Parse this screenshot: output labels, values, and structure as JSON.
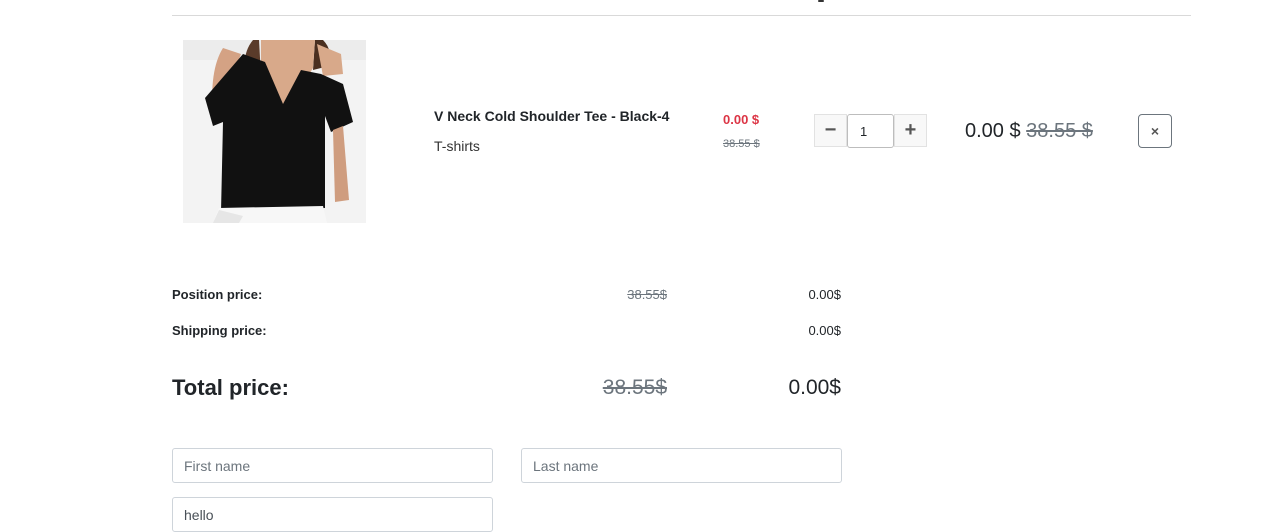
{
  "cart_item": {
    "name": "V Neck Cold Shoulder Tee - Black-4",
    "category": "T-shirts",
    "unit_price": "0.00 $",
    "unit_price_old": "38.55 $",
    "quantity": "1",
    "line_total": "0.00 $",
    "line_total_old": "38.55 $",
    "remove_symbol": "×",
    "minus_symbol": "−",
    "plus_symbol": "+",
    "image_icon": "product-photo"
  },
  "summary": {
    "position_label": "Position price:",
    "position_old": "38.55$",
    "position_new": "0.00$",
    "shipping_label": "Shipping price:",
    "shipping_new": "0.00$",
    "total_label": "Total price:",
    "total_old": "38.55$",
    "total_new": "0.00$"
  },
  "form": {
    "first_name_placeholder": "First name",
    "last_name_placeholder": "Last name",
    "third_field_value": "hello"
  },
  "colors": {
    "price_new": "#dc3545",
    "muted": "#6c757d"
  }
}
